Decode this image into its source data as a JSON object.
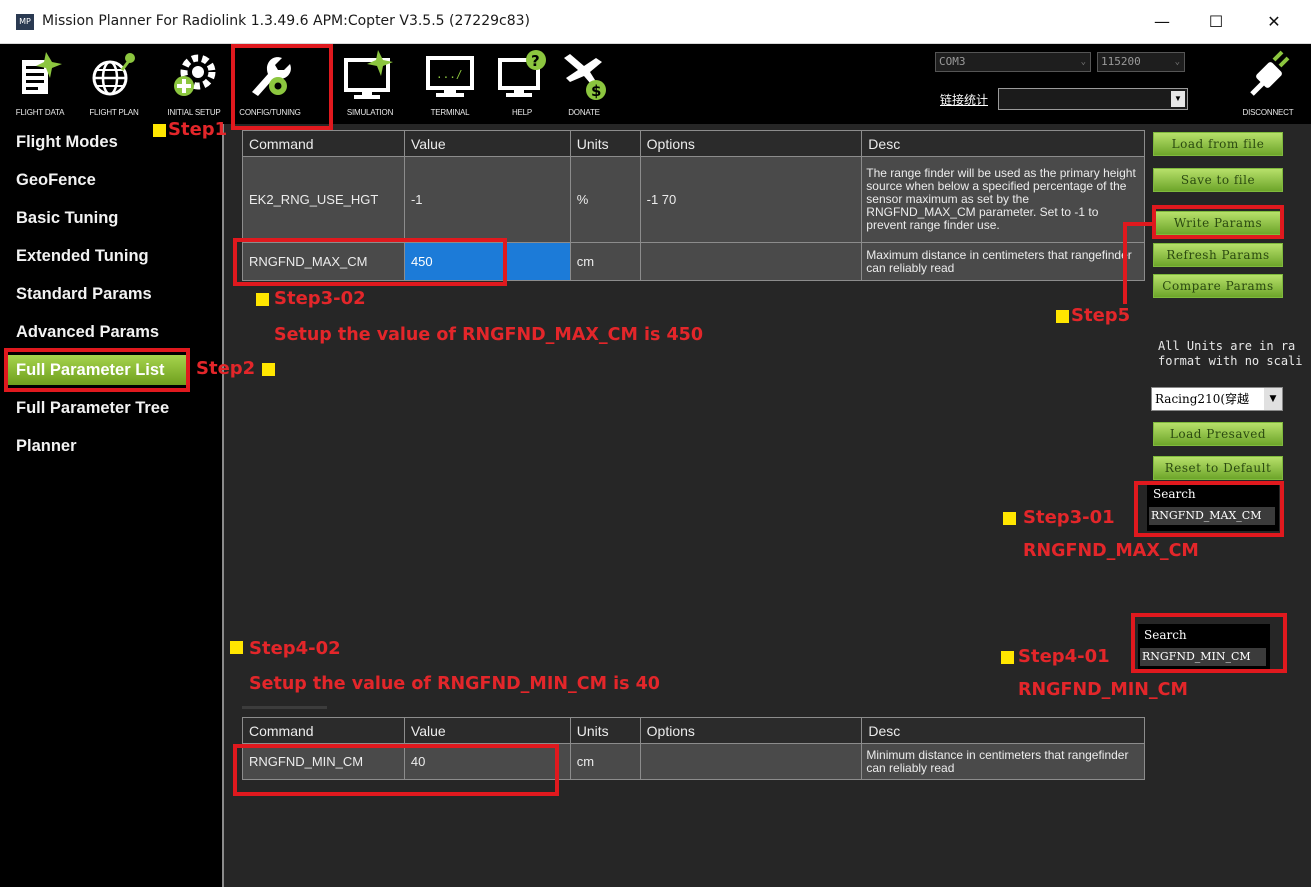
{
  "window": {
    "icon_text": "MP",
    "title": "Mission Planner For Radiolink 1.3.49.6 APM:Copter V3.5.5 (27229c83)",
    "minimize": "—",
    "maximize": "☐",
    "close": "✕"
  },
  "toolbar": {
    "items": [
      {
        "label": "FLIGHT DATA",
        "icon": "flight-data-icon"
      },
      {
        "label": "FLIGHT PLAN",
        "icon": "flight-plan-icon"
      },
      {
        "label": "INITIAL SETUP",
        "icon": "initial-setup-icon"
      },
      {
        "label": "CONFIG/TUNING",
        "icon": "config-tuning-icon"
      },
      {
        "label": "SIMULATION",
        "icon": "simulation-icon"
      },
      {
        "label": "TERMINAL",
        "icon": "terminal-icon"
      },
      {
        "label": "HELP",
        "icon": "help-icon"
      },
      {
        "label": "DONATE",
        "icon": "donate-icon"
      }
    ],
    "com_port": "COM3",
    "baud_rate": "115200",
    "stats_label": "链接统计",
    "disconnect_label": "DISCONNECT"
  },
  "sidebar": {
    "items": [
      {
        "label": "Flight Modes"
      },
      {
        "label": "GeoFence"
      },
      {
        "label": "Basic Tuning"
      },
      {
        "label": "Extended Tuning"
      },
      {
        "label": "Standard Params"
      },
      {
        "label": "Advanced Params"
      },
      {
        "label": "Full Parameter List",
        "active": true
      },
      {
        "label": "Full Parameter Tree"
      },
      {
        "label": "Planner"
      }
    ]
  },
  "params_table": {
    "headers": [
      "Command",
      "Value",
      "Units",
      "Options",
      "Desc"
    ],
    "rows": [
      {
        "command": "EK2_RNG_USE_HGT",
        "value": "-1",
        "units": "%",
        "options": "-1 70",
        "desc": "The range finder will be used as the primary height source when below a specified percentage of the sensor maximum as set by the RNGFND_MAX_CM parameter. Set to -1 to prevent range finder use."
      },
      {
        "command": "RNGFND_MAX_CM",
        "value": "450",
        "units": "cm",
        "options": "",
        "desc": "Maximum distance in centimeters that rangefinder can reliably read"
      }
    ]
  },
  "params_table_2": {
    "headers": [
      "Command",
      "Value",
      "Units",
      "Options",
      "Desc"
    ],
    "rows": [
      {
        "command": "RNGFND_MIN_CM",
        "value": "40",
        "units": "cm",
        "options": "",
        "desc": "Minimum distance in centimeters that rangefinder can reliably read"
      }
    ]
  },
  "right_panel": {
    "load_from_file": "Load from file",
    "save_to_file": "Save to file",
    "write_params": "Write Params",
    "refresh_params": "Refresh Params",
    "compare_params": "Compare Params",
    "units_note_line1": "All Units are in ra",
    "units_note_line2": "format with no scali",
    "preset_value": "Racing210(穿越",
    "load_presaved": "Load Presaved",
    "reset_default": "Reset to Default",
    "search_label": "Search",
    "search_value_1": "RNGFND_MAX_CM",
    "search_value_2": "RNGFND_MIN_CM"
  },
  "annotations": {
    "step1": "Step1",
    "step2": "Step2",
    "step3_01": "Step3-01",
    "step3_01_sub": "RNGFND_MAX_CM",
    "step3_02": "Step3-02",
    "step3_02_sub": "Setup the value of RNGFND_MAX_CM is 450",
    "step4_01": "Step4-01",
    "step4_01_sub": "RNGFND_MIN_CM",
    "step4_02": "Step4-02",
    "step4_02_sub": "Setup the value of RNGFND_MIN_CM is 40",
    "step5": "Step5"
  },
  "colors": {
    "annotation_red": "#e0191e",
    "highlight_yellow": "#ffe600",
    "active_green": "#8fc23a",
    "selection_blue": "#1c7bd8"
  }
}
